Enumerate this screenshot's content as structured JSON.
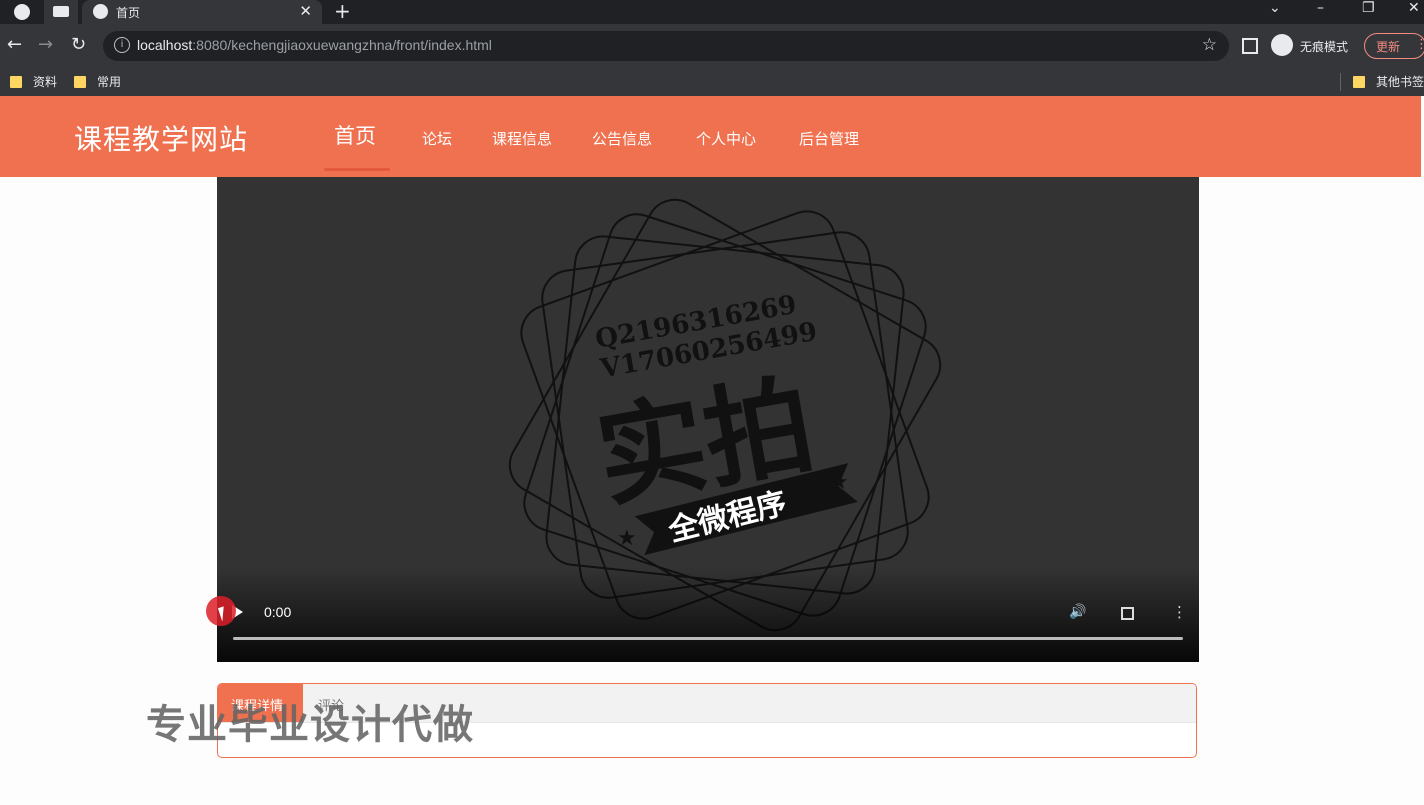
{
  "browser": {
    "tab_title": "首页",
    "url_host": "localhost",
    "url_rest": ":8080/kechengjiaoxuewangzhna/front/index.html",
    "incognito_label": "无痕模式",
    "update_label": "更新",
    "bookmarks": [
      "资料",
      "常用"
    ],
    "other_bookmarks": "其他书签"
  },
  "site": {
    "title": "课程教学网站",
    "nav": [
      "首页",
      "论坛",
      "课程信息",
      "公告信息",
      "个人中心",
      "后台管理"
    ],
    "active_nav": "首页",
    "accent_color": "#f0714f"
  },
  "video": {
    "time": "0:00",
    "progress": 0,
    "watermark_lines": [
      "Q2196316269",
      "V17060256499"
    ],
    "watermark_main": "实拍",
    "watermark_banner": "全微程序"
  },
  "course_panel": {
    "tabs": [
      "课程详情",
      "评论"
    ],
    "active_tab": "课程详情"
  },
  "overlay_text": "专业毕业设计代做"
}
